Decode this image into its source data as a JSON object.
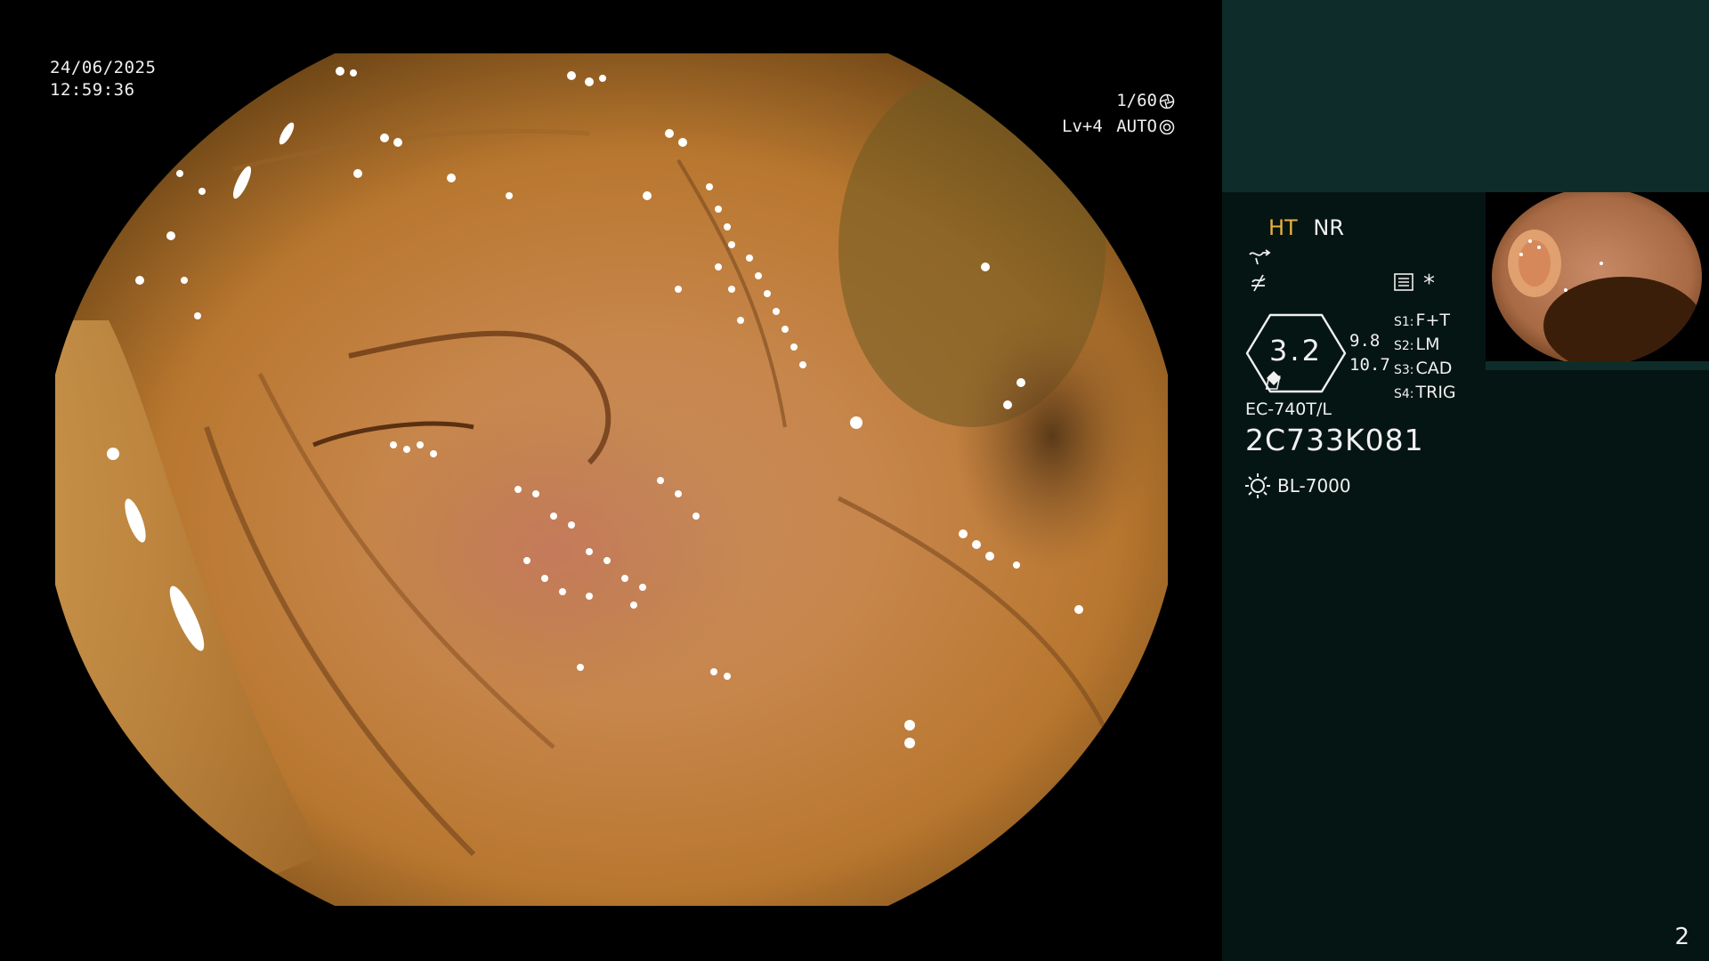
{
  "overlay": {
    "date": "24/06/2025",
    "time": "12:59:36",
    "shutter": "1/60",
    "level": "Lv+4",
    "mode": "AUTO"
  },
  "panel": {
    "mode_ht": "HT",
    "mode_nr": "NR",
    "asterisk": "*",
    "dial_value": "3.2",
    "side_values": [
      "9.8",
      "10.7"
    ],
    "switches": [
      {
        "key": "S1:",
        "value": "F+T"
      },
      {
        "key": "S2:",
        "value": "LM"
      },
      {
        "key": "S3:",
        "value": "CAD"
      },
      {
        "key": "S4:",
        "value": "TRIG"
      }
    ],
    "scope_model": "EC-740T/L",
    "serial": "2C733K081",
    "light_source": "BL-7000",
    "page_number": "2"
  },
  "colors": {
    "panel_bg": "#051513",
    "panel_top": "#0e2d2a",
    "ht_color": "#e8b040",
    "mucosa": "#c9884a"
  },
  "icons": {
    "shutter": "aperture-icon",
    "auto": "iris-icon",
    "tilde": "tilde-arrow-icon",
    "f-symbol": "slashed-f-icon",
    "record": "record-icon",
    "light": "light-bulb-icon"
  }
}
